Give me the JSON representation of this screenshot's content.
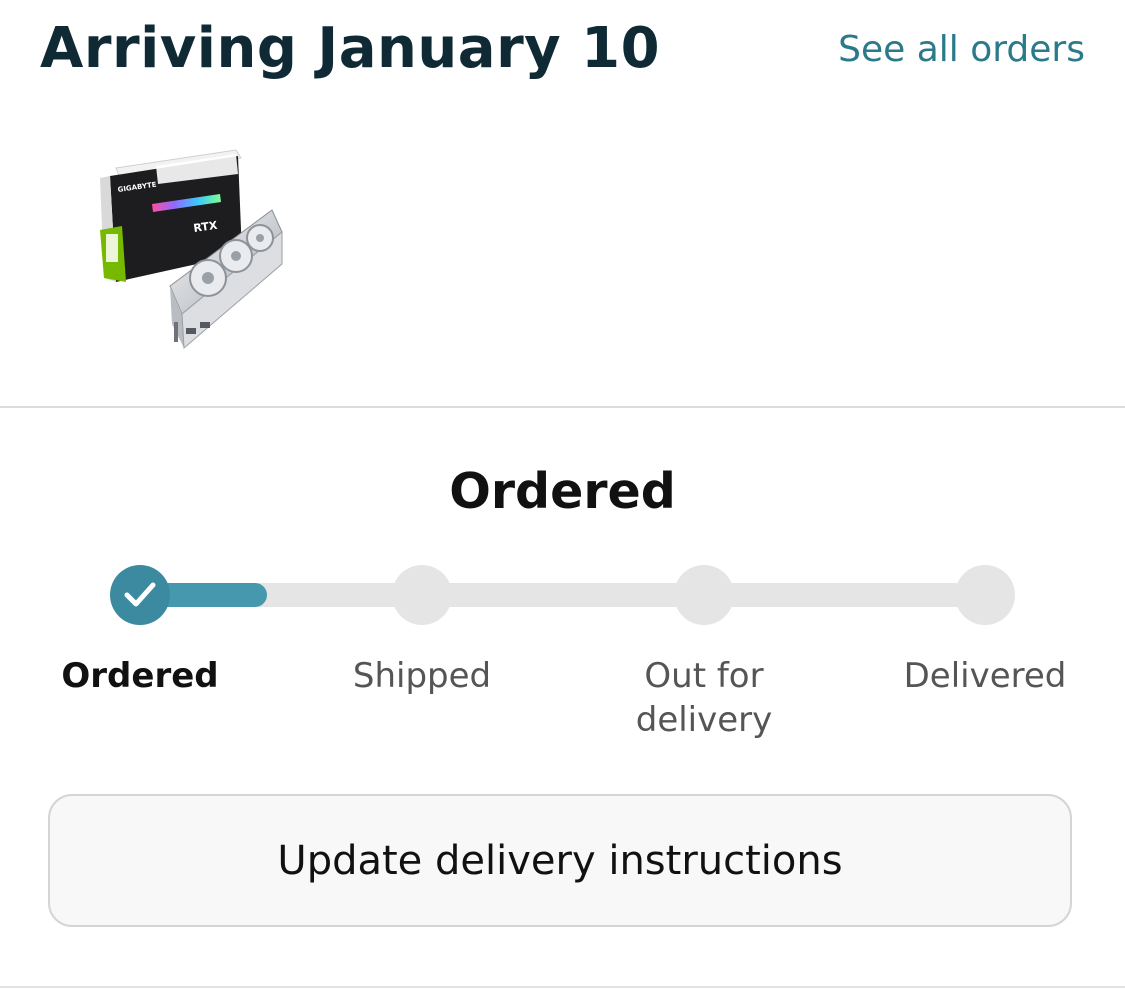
{
  "header": {
    "title": "Arriving January 10",
    "see_all_link": "See all orders"
  },
  "product": {
    "image_icon": "product-box-icon",
    "box_brand_text": "GIGABYTE",
    "box_product_text": "GEFORCE RTX"
  },
  "status": {
    "heading": "Ordered",
    "progress_fraction": 0.15,
    "current_step_index": 0
  },
  "steps": [
    {
      "label": "Ordered",
      "state": "complete"
    },
    {
      "label": "Shipped",
      "state": "pending"
    },
    {
      "label": "Out for delivery",
      "state": "pending"
    },
    {
      "label": "Delivered",
      "state": "pending"
    }
  ],
  "actions": {
    "update_delivery_label": "Update delivery instructions"
  },
  "colors": {
    "title": "#0f2a35",
    "link": "#2b7a8a",
    "progress_fill": "#4598ad",
    "step_done": "#3c8aa0",
    "track": "#e6e5e6"
  }
}
